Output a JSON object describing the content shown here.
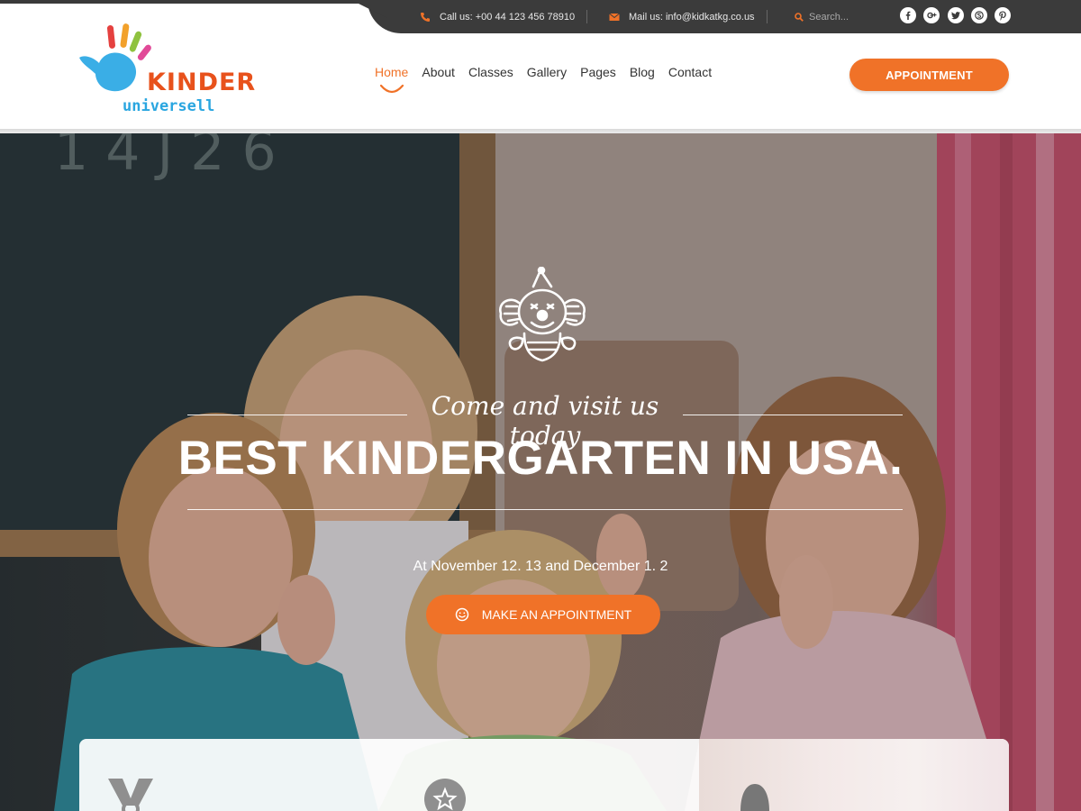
{
  "topbar": {
    "call": "Call us: +00 44 123 456 78910",
    "mail": "Mail us: info@kidkatkg.co.us",
    "search_placeholder": "Search...",
    "social": [
      "facebook-icon",
      "google-plus-icon",
      "twitter-icon",
      "skype-icon",
      "pinterest-icon"
    ]
  },
  "logo": {
    "word1": "KINDER",
    "word2": "universell"
  },
  "nav": {
    "items": [
      {
        "label": "Home",
        "active": true
      },
      {
        "label": "About",
        "active": false
      },
      {
        "label": "Classes",
        "active": false
      },
      {
        "label": "Gallery",
        "active": false
      },
      {
        "label": "Pages",
        "active": false
      },
      {
        "label": "Blog",
        "active": false
      },
      {
        "label": "Contact",
        "active": false
      }
    ]
  },
  "header": {
    "appointment_label": "APPOINTMENT"
  },
  "hero": {
    "script_title": "Come and visit us today",
    "title": "BEST KINDERGARTEN IN USA.",
    "date_text": "At November 12. 13 and December 1. 2",
    "cta_label": "MAKE AN APPOINTMENT"
  },
  "colors": {
    "accent": "#f07228",
    "topbar_bg": "#3b3b3b",
    "logo_orange": "#e8521c",
    "logo_blue": "#2aa6e0"
  }
}
